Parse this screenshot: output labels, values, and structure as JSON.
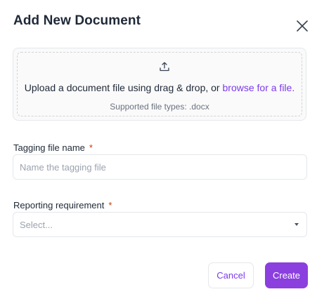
{
  "dialog": {
    "title": "Add New Document"
  },
  "upload": {
    "prompt": "Upload a document file using drag & drop, or ",
    "browse_link": "browse for a file.",
    "supported_types": "Supported file types: .docx"
  },
  "tagging_field": {
    "label": "Tagging file name",
    "required_marker": "*",
    "placeholder": "Name the tagging file",
    "value": ""
  },
  "reporting_field": {
    "label": "Reporting requirement",
    "required_marker": "*",
    "placeholder": "Select..."
  },
  "actions": {
    "cancel_label": "Cancel",
    "create_label": "Create"
  },
  "colors": {
    "accent": "#7c3aed",
    "primary_button": "#8b3fdf",
    "required": "#c2410c"
  },
  "icons": {
    "close": "close-icon",
    "upload": "upload-icon",
    "caret": "chevron-down-icon"
  }
}
